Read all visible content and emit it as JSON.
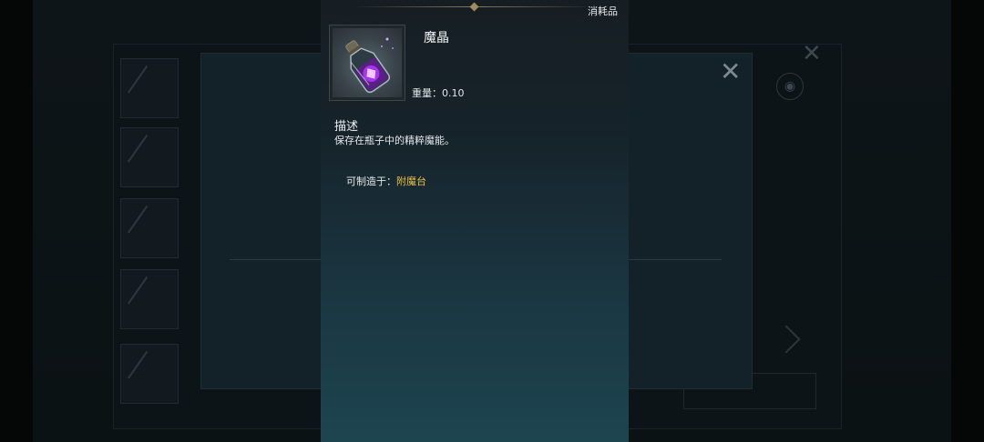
{
  "tooltip": {
    "category": "消耗品",
    "item_name": "魔晶",
    "weight_label": "重量：",
    "weight_value": "0.10",
    "description_heading": "描述",
    "description_text": "保存在瓶子中的精粹魔能。",
    "craftable_label": "可制造于：",
    "craftable_value": "附魔台",
    "item_icon": "purple-crystal-potion-icon"
  },
  "colors": {
    "accent_gold": "#e6c046",
    "ornament": "#9f8a62",
    "tooltip_top": "#161e23",
    "tooltip_bottom": "#1d4550"
  }
}
